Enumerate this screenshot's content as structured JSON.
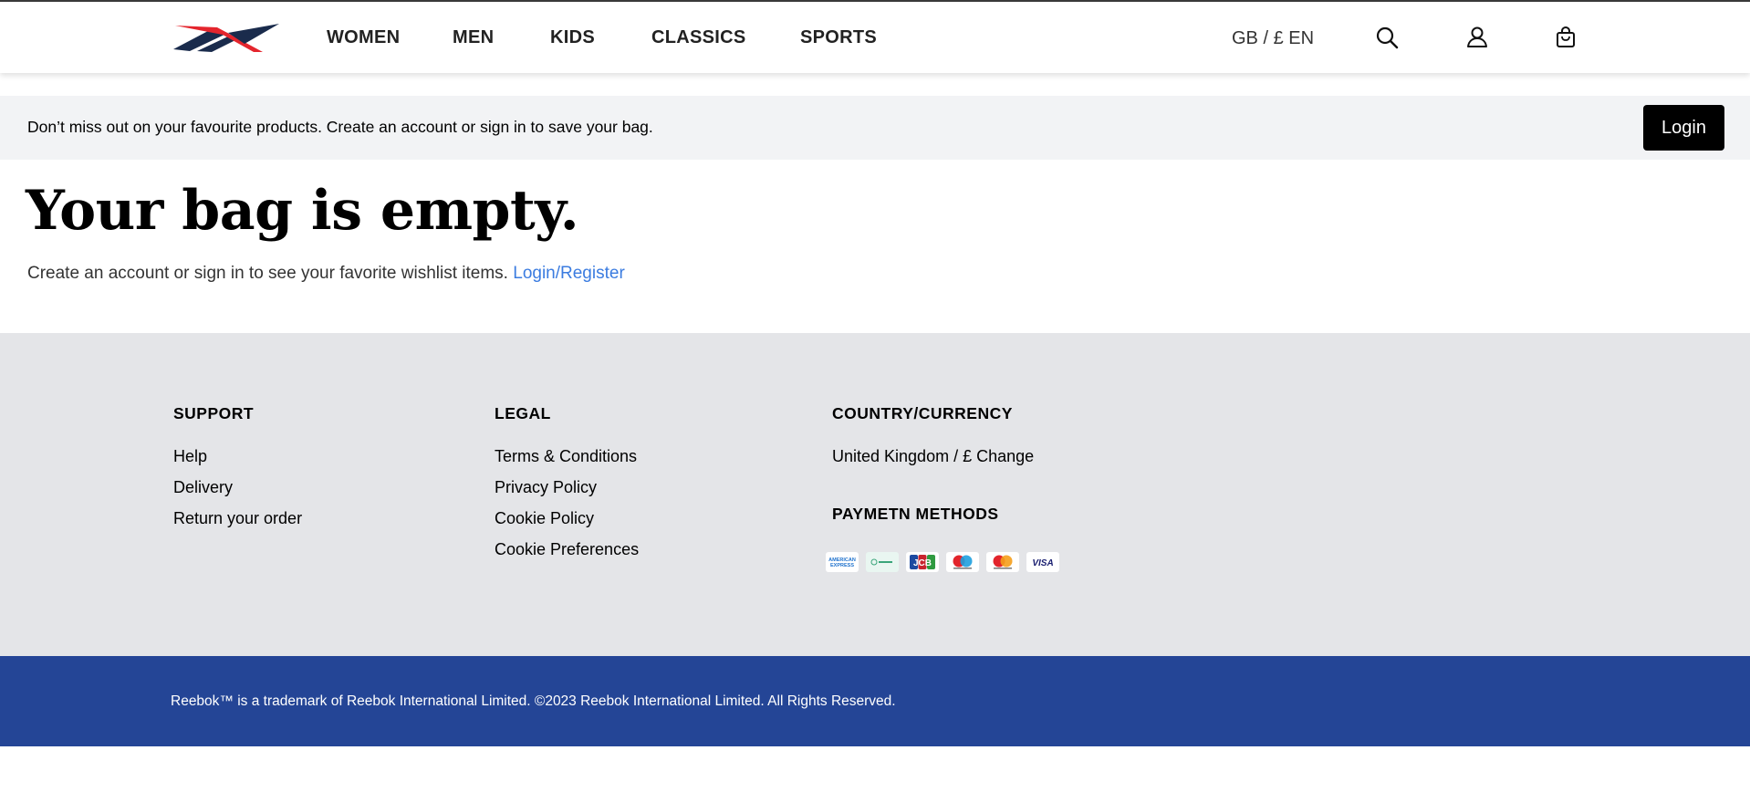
{
  "header": {
    "nav": [
      "WOMEN",
      "MEN",
      "KIDS",
      "CLASSICS",
      "SPORTS"
    ],
    "locale": "GB / £ EN",
    "icons": [
      "search-icon",
      "user-icon",
      "bag-icon"
    ]
  },
  "banner": {
    "text": "Don’t miss out on your favourite products. Create an account or sign in to save your bag.",
    "login_label": "Login"
  },
  "main": {
    "title": "Your bag is empty.",
    "subtitle": "Create an account or sign in to see your favorite wishlist items.",
    "link": "Login/Register"
  },
  "footer": {
    "support": {
      "heading": "SUPPORT",
      "links": [
        "Help",
        "Delivery",
        "Return your order"
      ]
    },
    "legal": {
      "heading": "LEGAL",
      "links": [
        "Terms & Conditions",
        "Privacy Policy",
        "Cookie Policy",
        "Cookie Preferences"
      ]
    },
    "country": {
      "heading": "COUNTRY/CURRENCY",
      "value": "United Kingdom / £ Change"
    },
    "payment": {
      "heading": "PAYMETN METHODS",
      "methods": [
        "american-express",
        "other-card",
        "jcb",
        "maestro",
        "mastercard",
        "visa"
      ]
    },
    "copyright": "Reebok™ is a trademark of Reebok International Limited. ©2023 Reebok International Limited. All Rights Reserved."
  },
  "colors": {
    "brand_blue": "#244596",
    "link_blue": "#3b7ce0",
    "logo_red": "#e4252d",
    "logo_navy": "#1a2b4c"
  }
}
